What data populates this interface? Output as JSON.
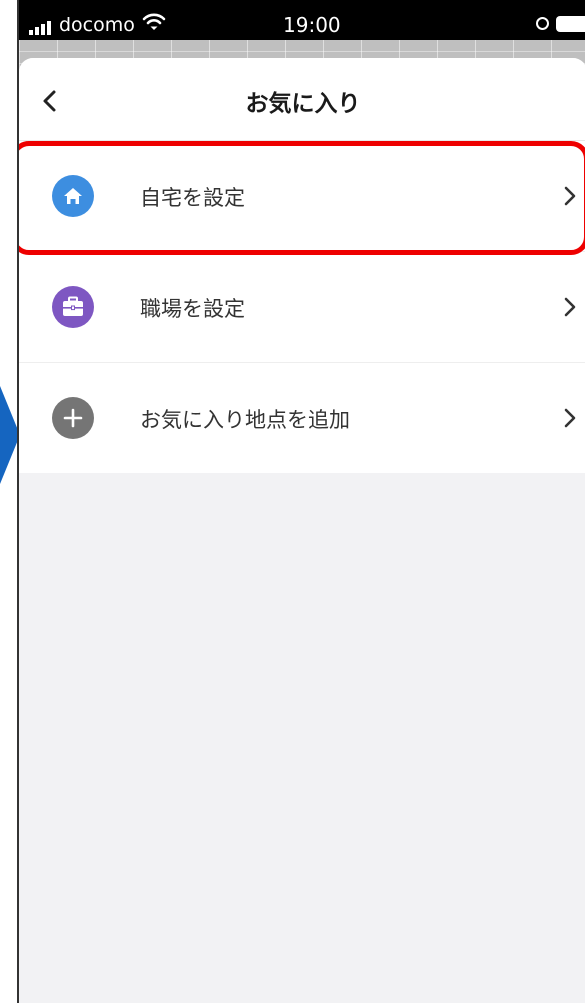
{
  "status_bar": {
    "carrier": "docomo",
    "time": "19:00"
  },
  "nav": {
    "title": "お気に入り"
  },
  "items": [
    {
      "label": "自宅を設定",
      "icon": "home-icon",
      "icon_color": "#3d8ee0"
    },
    {
      "label": "職場を設定",
      "icon": "briefcase-icon",
      "icon_color": "#7e57c2"
    },
    {
      "label": "お気に入り地点を追加",
      "icon": "plus-icon",
      "icon_color": "#757575"
    }
  ],
  "colors": {
    "highlight": "#ee0000",
    "guide_arrow": "#1565c0"
  }
}
